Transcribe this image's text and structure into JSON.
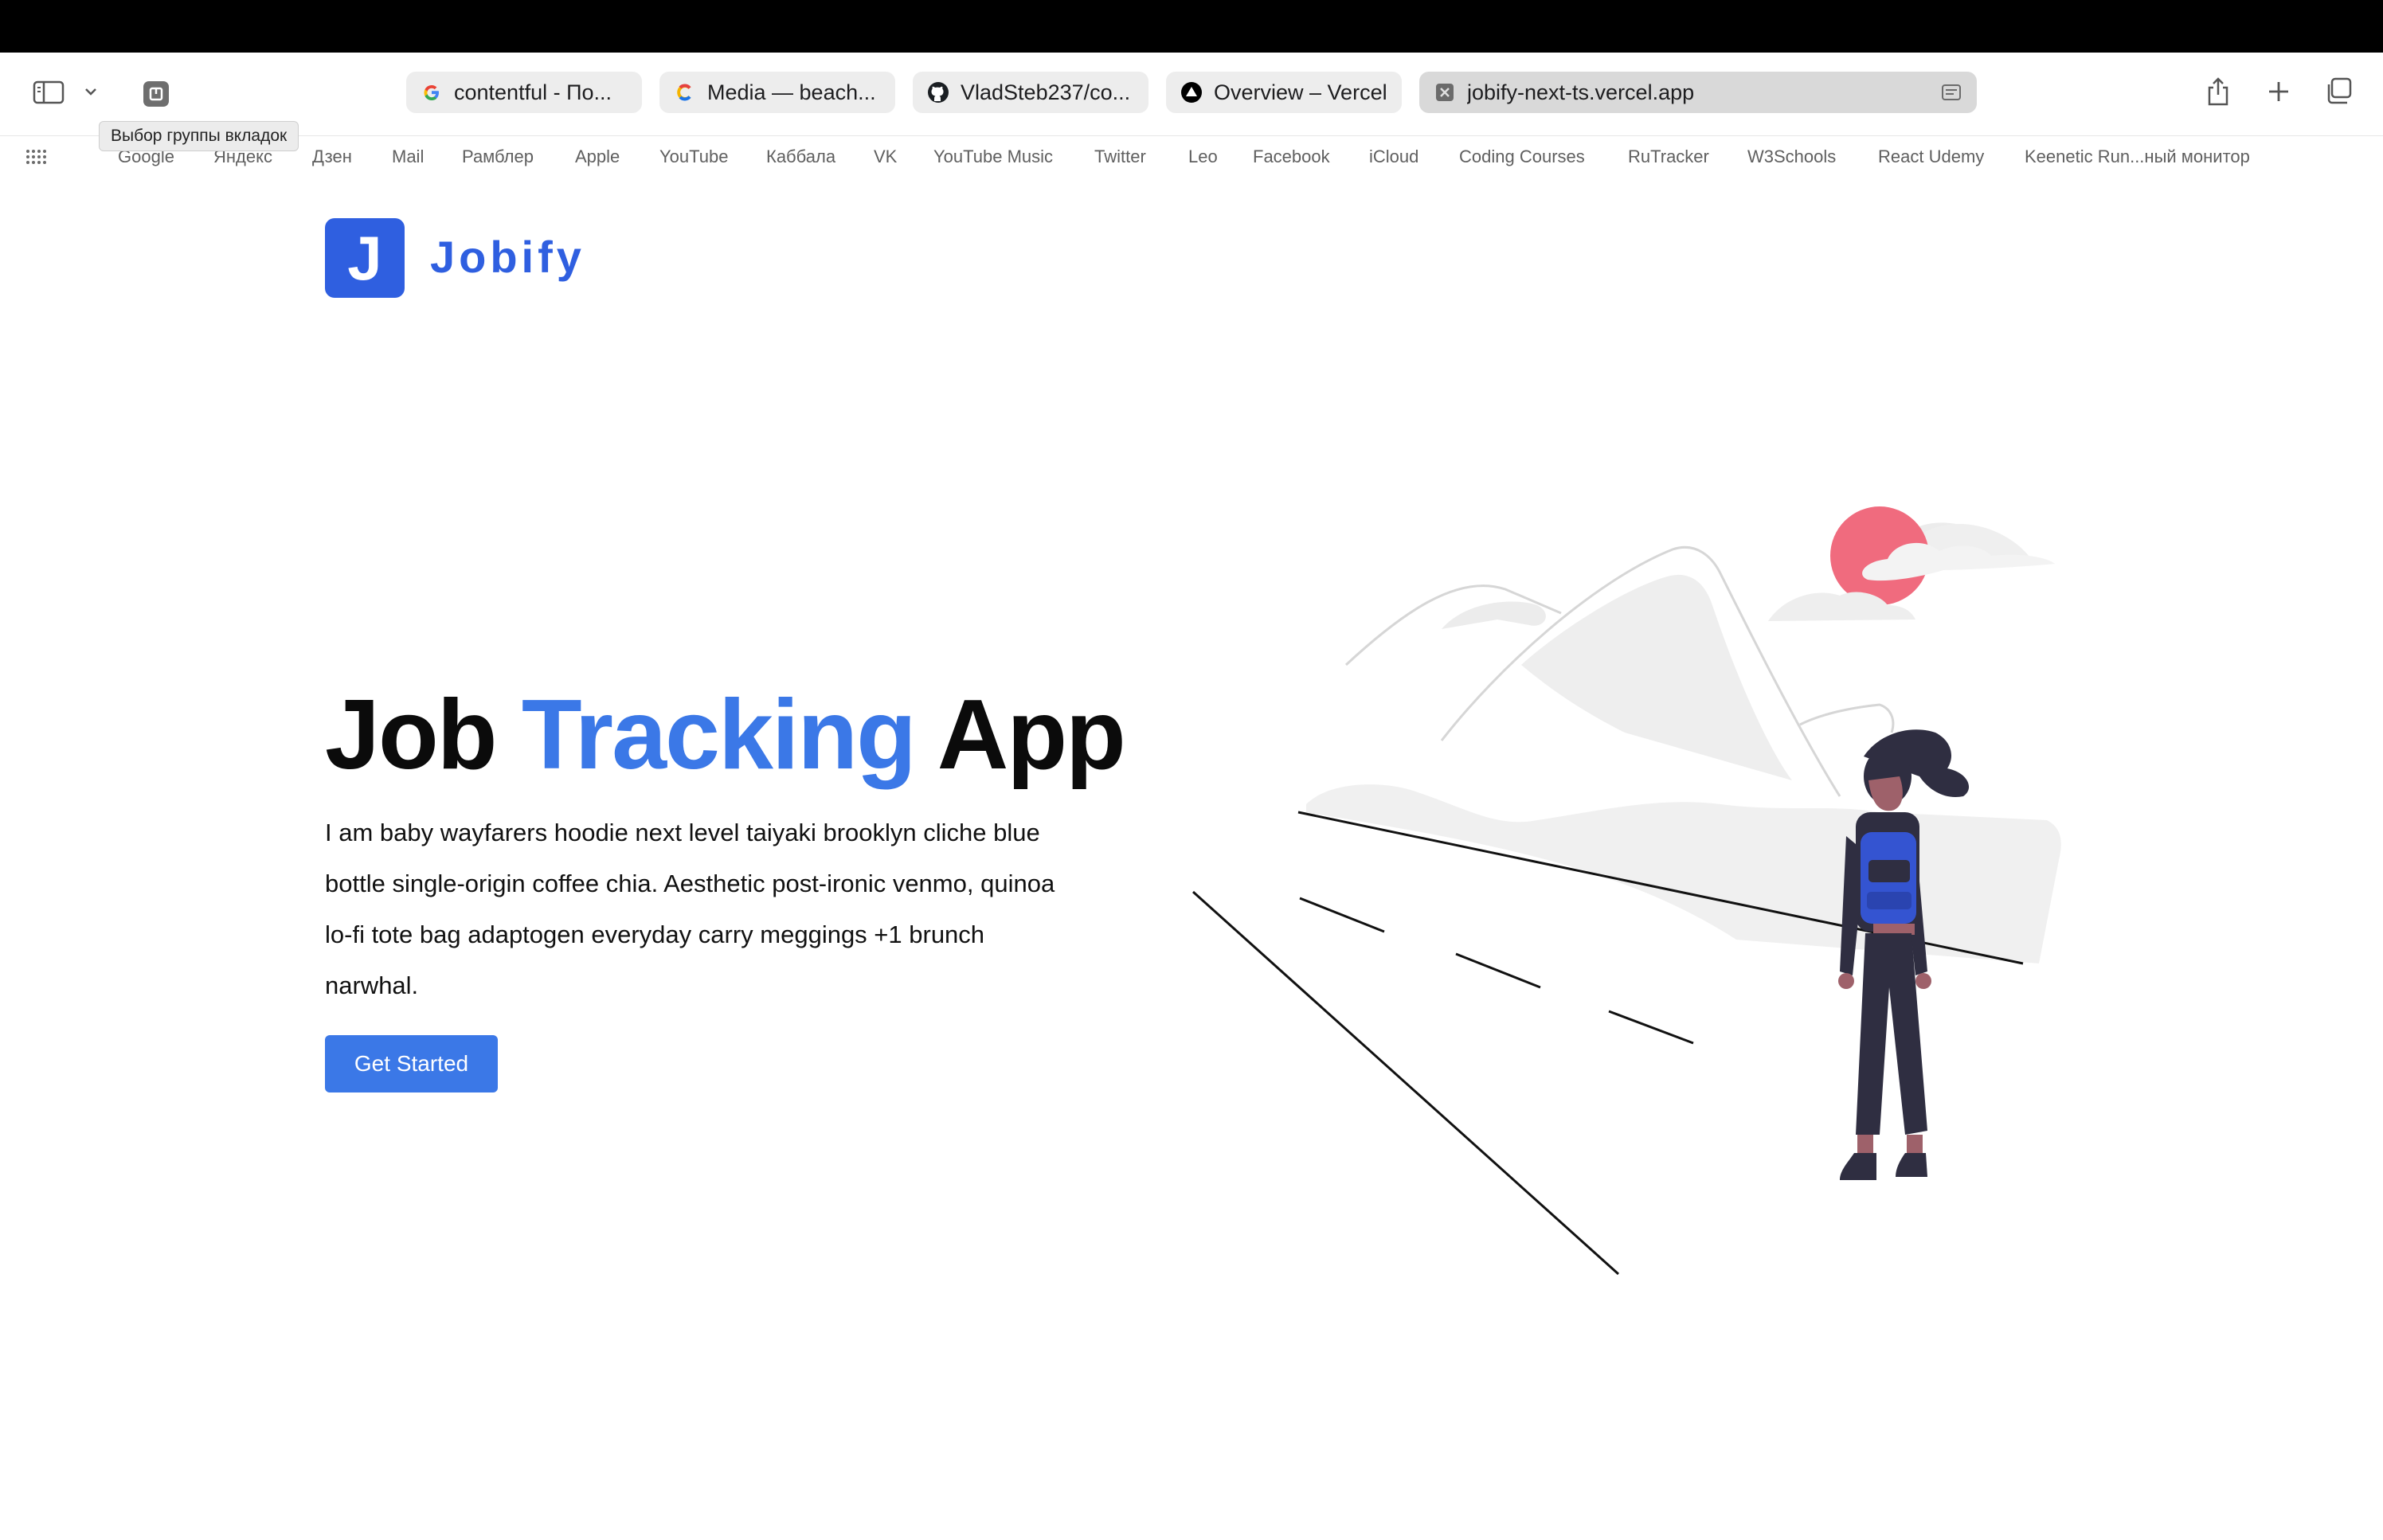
{
  "browser": {
    "tooltip": "Выбор группы вкладок",
    "tabs": [
      {
        "label": "contentful - По...",
        "icon": "google-g-icon"
      },
      {
        "label": "Media — beach...",
        "icon": "contentful-icon"
      },
      {
        "label": "VladSteb237/co...",
        "icon": "github-icon"
      },
      {
        "label": "Overview – Vercel",
        "icon": "vercel-triangle-icon"
      },
      {
        "label": "jobify-next-ts.vercel.app",
        "icon": "close-tab-icon",
        "active": true
      }
    ],
    "bookmarks": [
      "Google",
      "Яндекс",
      "Дзен",
      "Mail",
      "Рамблер",
      "Apple",
      "YouTube",
      "Каббала",
      "VK",
      "YouTube Music",
      "Twitter",
      "Leo",
      "Facebook",
      "iCloud",
      "Coding Courses",
      "RuTracker",
      "W3Schools",
      "React Udemy",
      "Keenetic Run...ный монитор"
    ]
  },
  "page": {
    "logo_letter": "J",
    "brand": "Jobify",
    "title_part1": "Job",
    "title_accent": "Tracking",
    "title_part2": "App",
    "description": "I am baby wayfarers hoodie next level taiyaki brooklyn cliche blue bottle single-origin coffee chia. Aesthetic post-ironic venmo, quinoa lo-fi tote bag adaptogen everyday carry meggings +1 brunch narwhal.",
    "cta_label": "Get Started"
  },
  "colors": {
    "brand": "#2f5fe0",
    "accent": "#3b78e7",
    "sun": "#f06b7e",
    "figure_dark": "#2f2e41",
    "backpack": "#3454d1"
  }
}
